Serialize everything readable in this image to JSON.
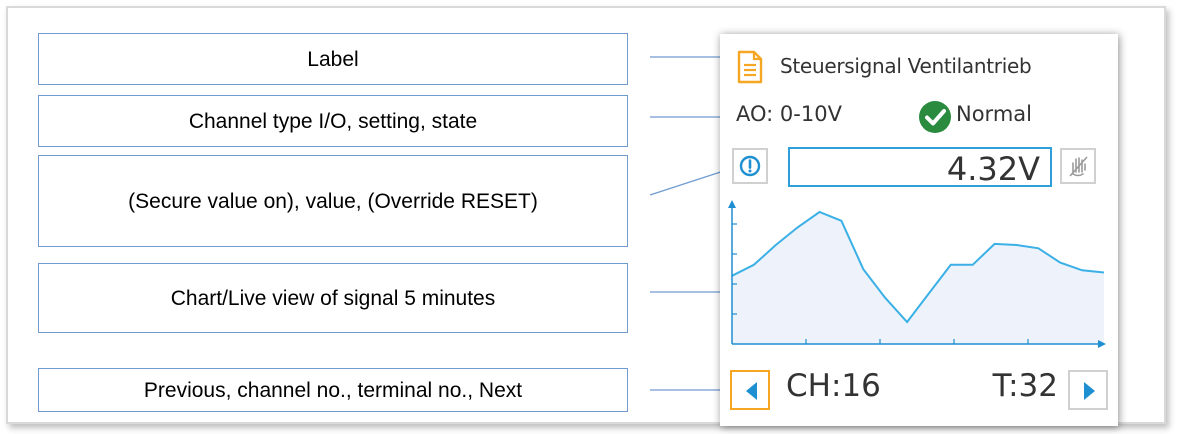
{
  "callouts": {
    "label": "Label",
    "channel_info": "Channel type I/O, setting, state",
    "value_row": "(Secure value on), value, (Override RESET)",
    "chart": "Chart/Live view of signal 5 minutes",
    "navigation": "Previous, channel no., terminal no., Next"
  },
  "panel": {
    "label": "Steuersignal Ventilantrieb",
    "io_setting": "AO: 0-10V",
    "state": "Normal",
    "value": "4.32V",
    "channel": "CH:16",
    "terminal": "T:32"
  },
  "icons": {
    "label": "document-icon",
    "state": "check-circle-icon",
    "secure": "exclamation-circle-icon",
    "override": "hand-strikethrough-icon",
    "previous": "triangle-left-icon",
    "next": "triangle-right-icon"
  },
  "colors": {
    "accent_blue": "#1e8fd0",
    "line_blue": "#3ab0e6",
    "fill_blue": "#eef3fb",
    "state_green": "#2a8a3e",
    "label_icon_orange": "#f5a623",
    "callout_border": "#6f9bd1"
  },
  "chart_data": {
    "type": "area",
    "series": [
      {
        "values": [
          0.42,
          0.52,
          0.7,
          0.86,
          1.0,
          0.92,
          0.48,
          0.22,
          0.0,
          0.26,
          0.52,
          0.52,
          0.71,
          0.7,
          0.67,
          0.54,
          0.47,
          0.45
        ]
      }
    ],
    "ylim": [
      0,
      1
    ],
    "grid": false
  }
}
